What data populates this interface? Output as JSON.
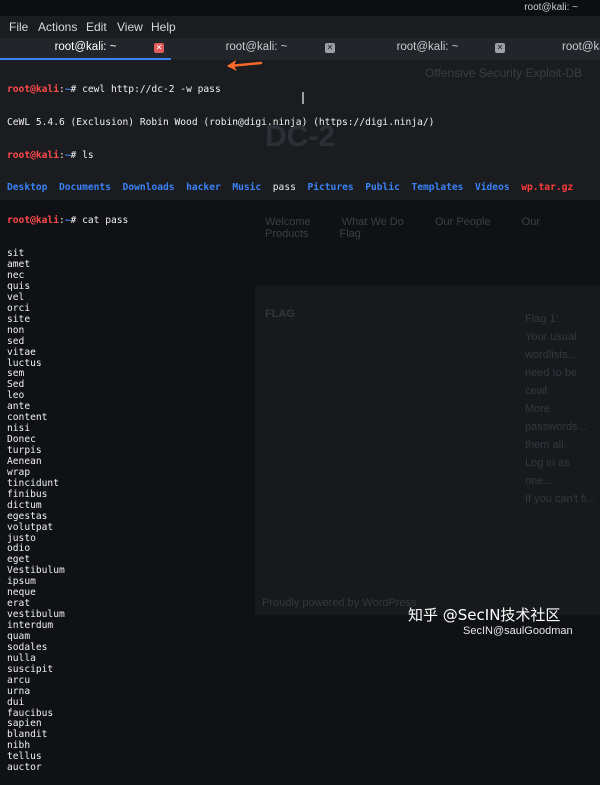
{
  "window": {
    "title": "root@kali: ~"
  },
  "menu": [
    "File",
    "Actions",
    "Edit",
    "View",
    "Help"
  ],
  "tabs": [
    {
      "label": "root@kali: ~",
      "active": true
    },
    {
      "label": "root@kali: ~",
      "active": false
    },
    {
      "label": "root@kali: ~",
      "active": false
    },
    {
      "label": "root@kali:",
      "active": false
    }
  ],
  "terminal": {
    "prompt_user": "root@kali",
    "prompt_sep": ":",
    "prompt_path": "~",
    "prompt_sym": "#",
    "cmd1": " cewl http://dc-2 -w pass",
    "cewl_output": "CeWL 5.4.6 (Exclusion) Robin Wood (robin@digi.ninja) (https://digi.ninja/)",
    "cmd2": " ls",
    "ls_items": [
      {
        "name": "Desktop",
        "kind": "dir"
      },
      {
        "name": "Documents",
        "kind": "dir"
      },
      {
        "name": "Downloads",
        "kind": "dir"
      },
      {
        "name": "hacker",
        "kind": "dir"
      },
      {
        "name": "Music",
        "kind": "dir"
      },
      {
        "name": "pass",
        "kind": "file"
      },
      {
        "name": "Pictures",
        "kind": "dir"
      },
      {
        "name": "Public",
        "kind": "dir"
      },
      {
        "name": "Templates",
        "kind": "dir"
      },
      {
        "name": "Videos",
        "kind": "dir"
      },
      {
        "name": "wp.tar.gz",
        "kind": "archive"
      }
    ],
    "cmd3": " cat pass",
    "words": [
      "sit",
      "amet",
      "nec",
      "quis",
      "vel",
      "orci",
      "site",
      "non",
      "sed",
      "vitae",
      "luctus",
      "sem",
      "Sed",
      "leo",
      "ante",
      "content",
      "nisi",
      "Donec",
      "turpis",
      "Aenean",
      "wrap",
      "tincidunt",
      "finibus",
      "dictum",
      "egestas",
      "volutpat",
      "justo",
      "odio",
      "eget",
      "Vestibulum",
      "ipsum",
      "neque",
      "erat",
      "vestibulum",
      "interdum",
      "quam",
      "sodales",
      "nulla",
      "suscipit",
      "arcu",
      "urna",
      "dui",
      "faucibus",
      "sapien",
      "blandit",
      "nibh",
      "tellus",
      "auctor"
    ]
  },
  "background_page": {
    "top_note": "Offensive Security   Exploit-DB",
    "site_title": "DC-2",
    "nav": [
      "Welcome",
      "What We Do",
      "Our People",
      "Our Products",
      "Flag"
    ],
    "flag_heading": "FLAG",
    "right_col": [
      "Flag 1:",
      "Your usual wordlists...",
      "need to be cewl.",
      "More passwords...",
      "them all.",
      "Log in as one...",
      "If you can't fi..."
    ],
    "footer": "Proudly powered by WordPress"
  },
  "watermark": {
    "brand": "知乎 @SecIN技术社区",
    "handle": "SecIN@saulGoodman"
  },
  "colors": {
    "prompt_user": "#ff4a4a",
    "prompt_path": "#3b82f6",
    "dir": "#3b82f6",
    "archive": "#ff3b3b",
    "arrow": "#ff6a2a",
    "tab_active_underline": "#3b82f6"
  }
}
